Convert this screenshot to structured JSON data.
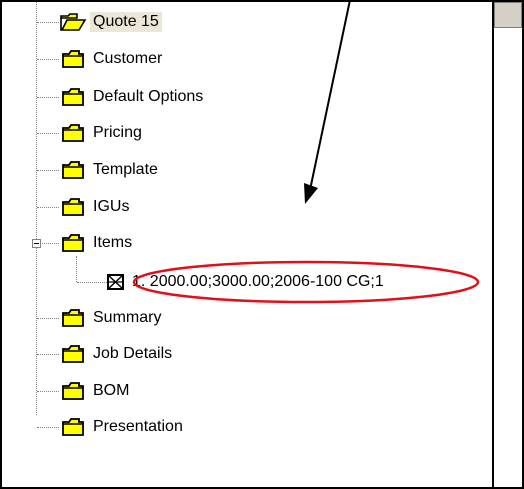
{
  "tree": {
    "items": [
      {
        "label": "Quote 15",
        "icon": "open-folder-icon"
      },
      {
        "label": "Customer",
        "icon": "folder-icon"
      },
      {
        "label": "Default Options",
        "icon": "folder-icon"
      },
      {
        "label": "Pricing",
        "icon": "folder-icon"
      },
      {
        "label": "Template",
        "icon": "folder-icon"
      },
      {
        "label": "IGUs",
        "icon": "folder-icon"
      },
      {
        "label": "Items",
        "icon": "folder-icon"
      },
      {
        "label": "1. 2000.00;3000.00;2006-100 CG;1",
        "icon": "window-item-icon"
      },
      {
        "label": "Summary",
        "icon": "folder-icon"
      },
      {
        "label": "Job Details",
        "icon": "folder-icon"
      },
      {
        "label": "BOM",
        "icon": "folder-icon"
      },
      {
        "label": "Presentation",
        "icon": "folder-icon"
      }
    ]
  },
  "annotation": {
    "circle_color": "#e0101a",
    "arrow_color": "#000000"
  },
  "colors": {
    "folder_fill": "#ffff00",
    "folder_outline": "#000000",
    "selection_bg": "#ebe6d8"
  }
}
